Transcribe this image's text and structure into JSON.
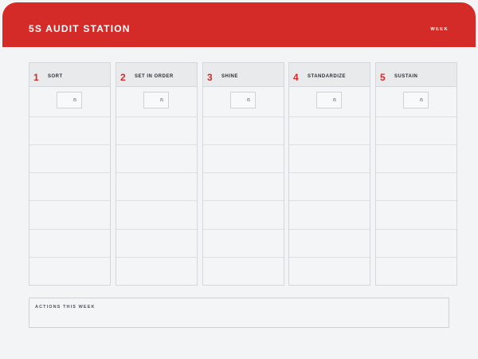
{
  "header": {
    "title": "5S AUDIT STATION",
    "week_label": "WEEK"
  },
  "colors": {
    "accent": "#d42b28",
    "background": "#f3f4f6",
    "header_text": "#ffffff"
  },
  "columns": [
    {
      "number": "1",
      "name": "SORT",
      "score_max": "/5"
    },
    {
      "number": "2",
      "name": "SET IN ORDER",
      "score_max": "/5"
    },
    {
      "number": "3",
      "name": "SHINE",
      "score_max": "/5"
    },
    {
      "number": "4",
      "name": "STANDARDIZE",
      "score_max": "/5"
    },
    {
      "number": "5",
      "name": "SUSTAIN",
      "score_max": "/5"
    }
  ],
  "actions": {
    "label": "ACTIONS THIS WEEK"
  }
}
